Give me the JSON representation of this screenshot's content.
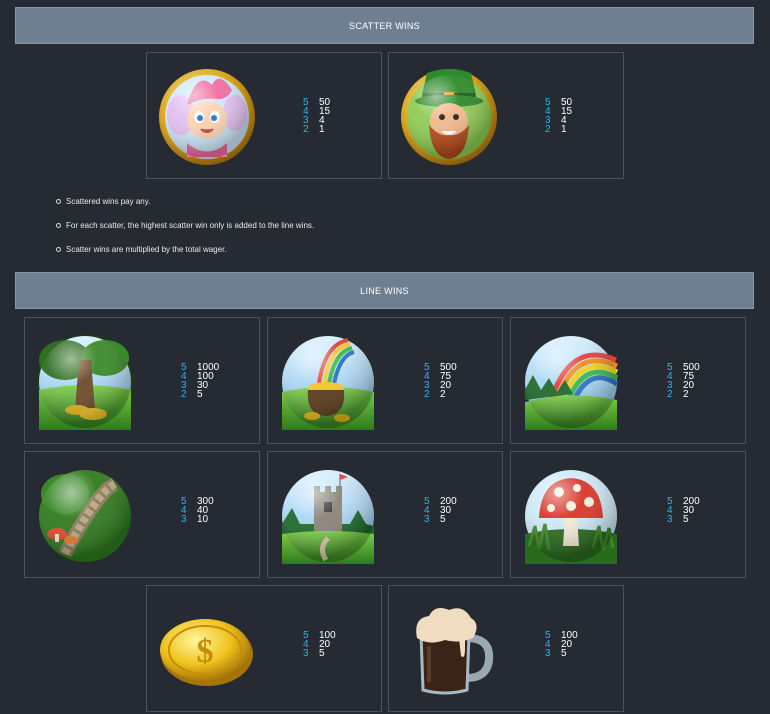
{
  "scatter": {
    "header": "SCATTER WINS",
    "symbols": [
      {
        "name": "fairy-symbol",
        "pays": [
          {
            "n": "5",
            "v": "50"
          },
          {
            "n": "4",
            "v": "15"
          },
          {
            "n": "3",
            "v": "4"
          },
          {
            "n": "2",
            "v": "1"
          }
        ]
      },
      {
        "name": "leprechaun-symbol",
        "pays": [
          {
            "n": "5",
            "v": "50"
          },
          {
            "n": "4",
            "v": "15"
          },
          {
            "n": "3",
            "v": "4"
          },
          {
            "n": "2",
            "v": "1"
          }
        ]
      }
    ],
    "notes": [
      "Scattered wins pay any.",
      "For each scatter, the highest scatter win only is added to the line wins.",
      "Scatter wins are multiplied by the total wager."
    ]
  },
  "line": {
    "header": "LINE WINS",
    "symbols": [
      {
        "name": "tree-gold-symbol",
        "pays": [
          {
            "n": "5",
            "v": "1000"
          },
          {
            "n": "4",
            "v": "100"
          },
          {
            "n": "3",
            "v": "30"
          },
          {
            "n": "2",
            "v": "5"
          }
        ]
      },
      {
        "name": "pot-of-gold-symbol",
        "pays": [
          {
            "n": "5",
            "v": "500"
          },
          {
            "n": "4",
            "v": "75"
          },
          {
            "n": "3",
            "v": "20"
          },
          {
            "n": "2",
            "v": "2"
          }
        ]
      },
      {
        "name": "rainbow-symbol",
        "pays": [
          {
            "n": "5",
            "v": "500"
          },
          {
            "n": "4",
            "v": "75"
          },
          {
            "n": "3",
            "v": "20"
          },
          {
            "n": "2",
            "v": "2"
          }
        ]
      },
      {
        "name": "stone-path-symbol",
        "pays": [
          {
            "n": "5",
            "v": "300"
          },
          {
            "n": "4",
            "v": "40"
          },
          {
            "n": "3",
            "v": "10"
          }
        ]
      },
      {
        "name": "castle-symbol",
        "pays": [
          {
            "n": "5",
            "v": "200"
          },
          {
            "n": "4",
            "v": "30"
          },
          {
            "n": "3",
            "v": "5"
          }
        ]
      },
      {
        "name": "mushroom-symbol",
        "pays": [
          {
            "n": "5",
            "v": "200"
          },
          {
            "n": "4",
            "v": "30"
          },
          {
            "n": "3",
            "v": "5"
          }
        ]
      },
      {
        "name": "gold-coin-symbol",
        "pays": [
          {
            "n": "5",
            "v": "100"
          },
          {
            "n": "4",
            "v": "20"
          },
          {
            "n": "3",
            "v": "5"
          }
        ]
      },
      {
        "name": "beer-mug-symbol",
        "pays": [
          {
            "n": "5",
            "v": "100"
          },
          {
            "n": "4",
            "v": "20"
          },
          {
            "n": "3",
            "v": "5"
          }
        ]
      }
    ]
  }
}
